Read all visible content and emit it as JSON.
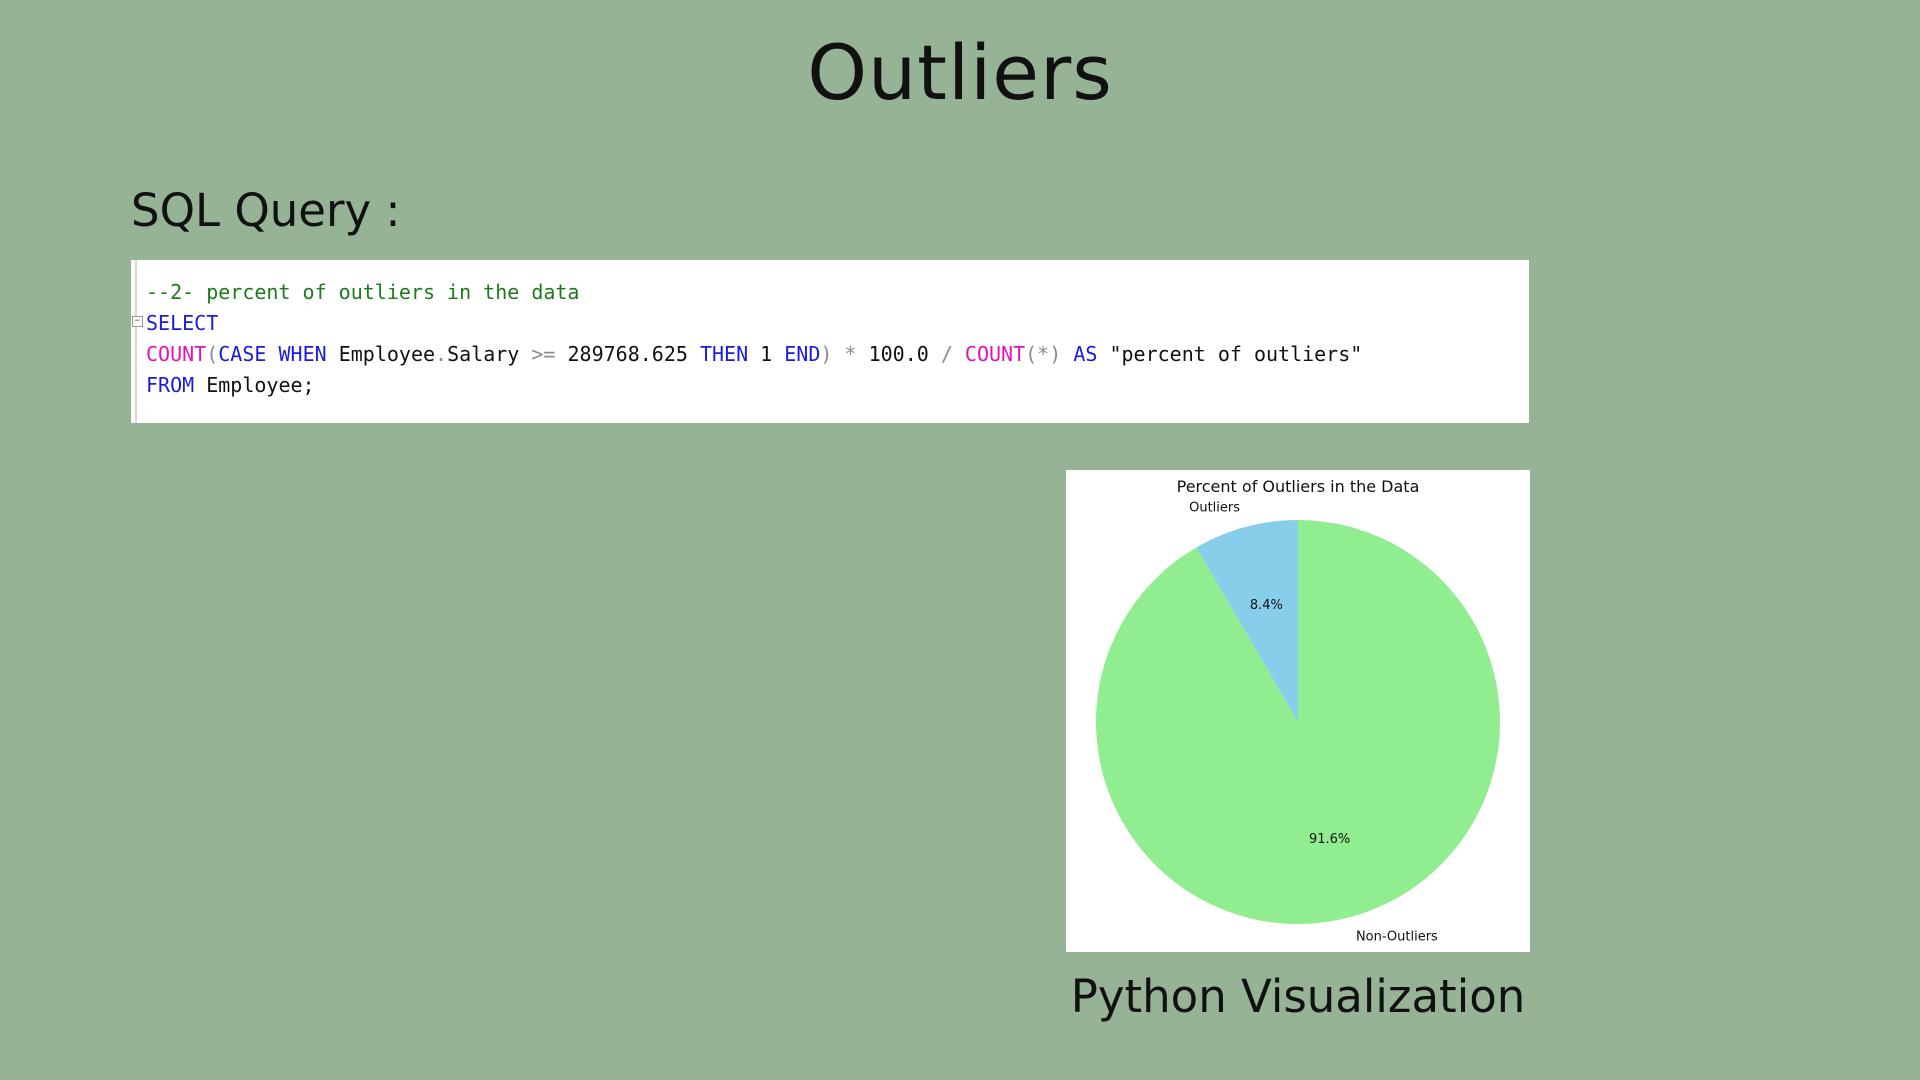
{
  "slide": {
    "title": "Outliers",
    "subtitle": "SQL Query :",
    "caption": "Python Visualization"
  },
  "code": {
    "line1": "--2- percent of outliers in the data",
    "line2_kw": "SELECT",
    "line3": [
      {
        "t": "COUNT",
        "c": "fn"
      },
      {
        "t": "(",
        "c": "op"
      },
      {
        "t": "CASE",
        "c": "kw"
      },
      {
        "t": " ",
        "c": "txt"
      },
      {
        "t": "WHEN",
        "c": "kw"
      },
      {
        "t": " Employee",
        "c": "txt"
      },
      {
        "t": ".",
        "c": "op"
      },
      {
        "t": "Salary ",
        "c": "txt"
      },
      {
        "t": ">=",
        "c": "op"
      },
      {
        "t": " 289768.625 ",
        "c": "txt"
      },
      {
        "t": "THEN",
        "c": "kw"
      },
      {
        "t": " 1 ",
        "c": "txt"
      },
      {
        "t": "END",
        "c": "kw"
      },
      {
        "t": ")",
        "c": "op"
      },
      {
        "t": " ",
        "c": "txt"
      },
      {
        "t": "*",
        "c": "op"
      },
      {
        "t": " 100.0 ",
        "c": "txt"
      },
      {
        "t": "/",
        "c": "op"
      },
      {
        "t": " ",
        "c": "txt"
      },
      {
        "t": "COUNT",
        "c": "fn"
      },
      {
        "t": "(*)",
        "c": "op"
      },
      {
        "t": " ",
        "c": "txt"
      },
      {
        "t": "AS",
        "c": "kw"
      },
      {
        "t": " \"percent of outliers\"",
        "c": "str"
      }
    ],
    "line4_kw": "FROM",
    "line4_rest": " Employee;"
  },
  "chart_data": {
    "type": "pie",
    "title": "Percent of Outliers in the Data",
    "slices": [
      {
        "label": "Outliers",
        "value": 8.4,
        "pct_label": "8.4%",
        "color": "#87ceeb"
      },
      {
        "label": "Non-Outliers",
        "value": 91.6,
        "pct_label": "91.6%",
        "color": "#90ee90"
      }
    ],
    "start_angle_deg": 90,
    "direction": "counterclockwise"
  }
}
